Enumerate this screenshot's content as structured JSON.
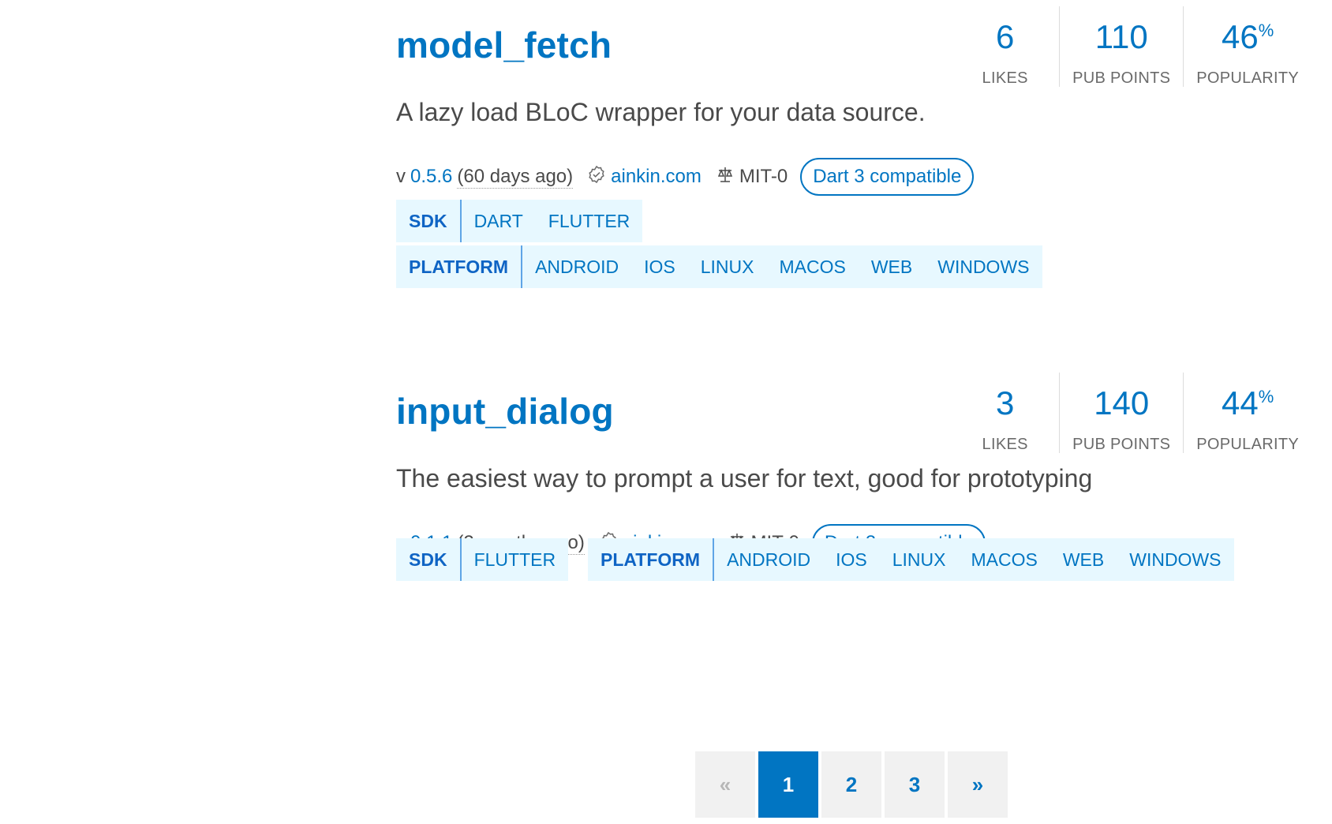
{
  "packages": [
    {
      "name": "model_fetch",
      "description": "A lazy load BLoC wrapper for your data source.",
      "likes": "6",
      "pub_points": "110",
      "popularity": "46",
      "popularity_unit": "%",
      "likes_label": "LIKES",
      "points_label": "PUB POINTS",
      "popularity_label": "POPULARITY",
      "version_prefix": "v",
      "version": "0.5.6",
      "age": "(60 days ago)",
      "publisher": "ainkin.com",
      "license": "MIT-0",
      "compat": "Dart 3 compatible",
      "sdk_label": "SDK",
      "sdk": [
        "DART",
        "FLUTTER"
      ],
      "platform_label": "PLATFORM",
      "platforms": [
        "ANDROID",
        "IOS",
        "LINUX",
        "MACOS",
        "WEB",
        "WINDOWS"
      ]
    },
    {
      "name": "input_dialog",
      "description": "The easiest way to prompt a user for text, good for prototyping",
      "likes": "3",
      "pub_points": "140",
      "popularity": "44",
      "popularity_unit": "%",
      "likes_label": "LIKES",
      "points_label": "PUB POINTS",
      "popularity_label": "POPULARITY",
      "version_prefix": "v",
      "version": "0.1.1",
      "age": "(2 months ago)",
      "publisher": "ainkin.com",
      "license": "MIT-0",
      "compat": "Dart 3 compatible",
      "sdk_label": "SDK",
      "sdk": [
        "FLUTTER"
      ],
      "platform_label": "PLATFORM",
      "platforms": [
        "ANDROID",
        "IOS",
        "LINUX",
        "MACOS",
        "WEB",
        "WINDOWS"
      ]
    }
  ],
  "pagination": {
    "prev": "«",
    "pages": [
      "1",
      "2",
      "3"
    ],
    "current": "1",
    "next": "»"
  },
  "icons": {
    "publisher": "verified-badge-icon",
    "license": "scale-icon"
  },
  "colors": {
    "accent": "#0175c2",
    "tag_bg": "#e7f8ff"
  }
}
